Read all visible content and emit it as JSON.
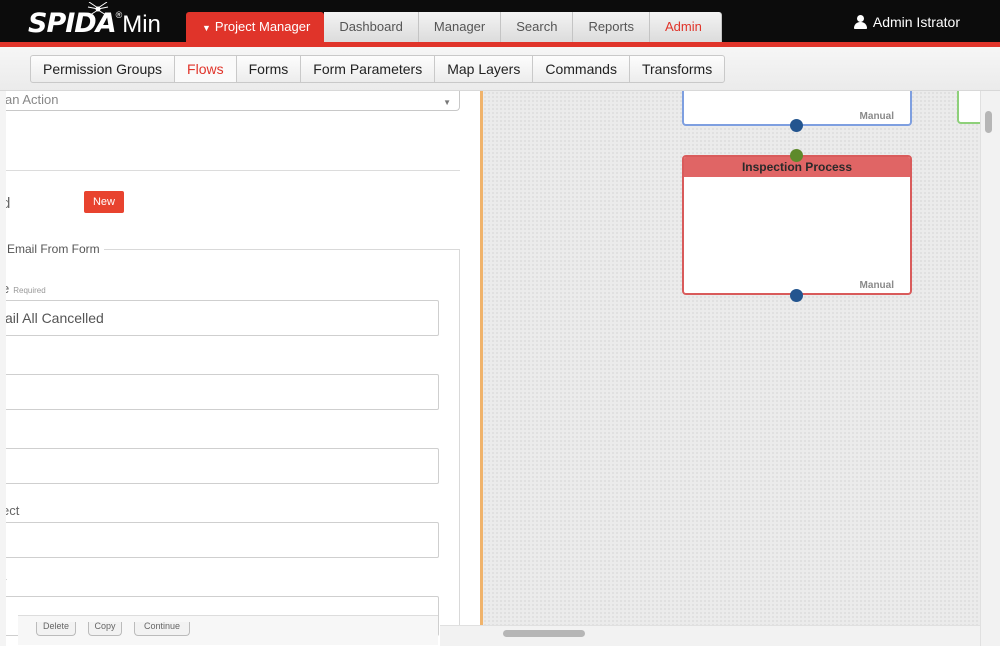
{
  "brand": {
    "logo_main": "SPIDA",
    "logo_reg": "®",
    "logo_sub": "Min"
  },
  "main_nav": {
    "tabs": [
      {
        "label": "Project Manager"
      },
      {
        "label": "Dashboard"
      },
      {
        "label": "Manager"
      },
      {
        "label": "Search"
      },
      {
        "label": "Reports"
      },
      {
        "label": "Admin"
      }
    ]
  },
  "user": {
    "name": "Admin Istrator"
  },
  "sub_nav": {
    "tabs": [
      {
        "label": "Permission Groups"
      },
      {
        "label": "Flows"
      },
      {
        "label": "Forms"
      },
      {
        "label": "Form Parameters"
      },
      {
        "label": "Map Layers"
      },
      {
        "label": "Commands"
      },
      {
        "label": "Transforms"
      }
    ],
    "active": "Flows"
  },
  "editor": {
    "action_select_value": "an Action",
    "field_label_partial": "d",
    "new_button": "New",
    "fieldset_legend": "Email From Form",
    "fields": [
      {
        "label": "e",
        "required": "Required",
        "value": "ail All Cancelled"
      },
      {
        "label": "",
        "value": ""
      },
      {
        "label": "",
        "value": ""
      },
      {
        "label": "ect",
        "value": ""
      },
      {
        "label": "v",
        "value": ""
      }
    ],
    "buttons": [
      "Delete",
      "Copy",
      "Continue"
    ]
  },
  "canvas": {
    "nodes": [
      {
        "title": "",
        "footer": "Manual"
      },
      {
        "title": "Inspection Process",
        "footer": "Manual"
      }
    ]
  },
  "colors": {
    "accent": "#e0342a",
    "node_blue": "#7e9fe0",
    "node_red": "#d95b5b",
    "node_green": "#8ed07a"
  }
}
